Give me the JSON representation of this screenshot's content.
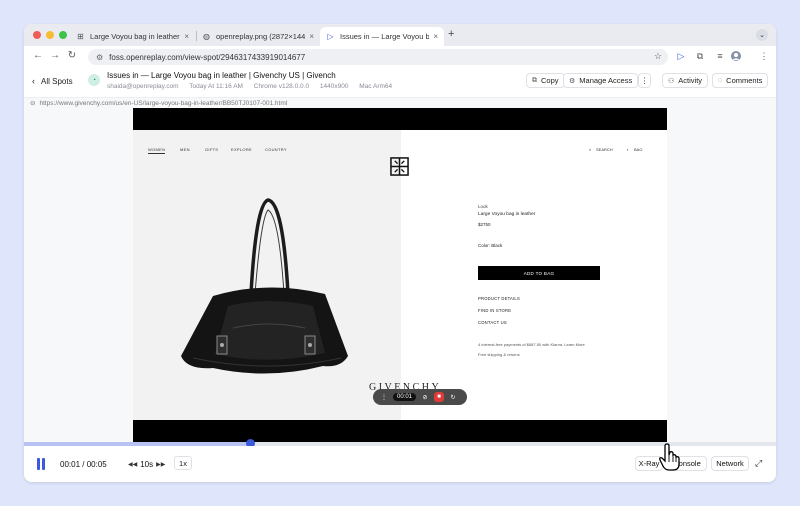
{
  "browser": {
    "tabs": [
      {
        "icon": "grid-icon",
        "label": "Large Voyou bag in leather | G"
      },
      {
        "icon": "globe-icon",
        "label": "openreplay.png (2872×1446)"
      },
      {
        "icon": "play-icon",
        "label": "Issues in — Large Voyou bag in"
      }
    ],
    "address": "foss.openreplay.com/view-spot/2946317433919014677"
  },
  "spot": {
    "back_label": "All Spots",
    "title": "Issues in — Large Voyou bag in leather | Givenchy US | Givench",
    "meta": [
      "shaida@openreplay.com",
      "Today At 11:16 AM",
      "Chrome v128.0.0.0",
      "1440x900",
      "Mac Arm64"
    ],
    "copy_label": "Copy",
    "manage_label": "Manage Access",
    "activity_label": "Activity",
    "comments_label": "Comments",
    "page_url": "https://www.givenchy.com/us/en-US/large-voyou-bag-in-leather/BB50TJ0107-001.html"
  },
  "site": {
    "nav": [
      "WOMEN",
      "MEN",
      "GIFTS",
      "EXPLORE",
      "COUNTRY"
    ],
    "search": "SEARCH",
    "bag": "BAG",
    "wordmark": "GIVENCHY",
    "product_label": "Look",
    "product_title": "Large Voyou bag in leather",
    "price": "$2750",
    "color": "Color: Black",
    "add_to_bag": "ADD TO BAG",
    "links": [
      "PRODUCT DETAILS",
      "FIND IN STORE",
      "CONTACT US"
    ],
    "note1": "4 interest-free payments of $687.50 with Klarna. Learn More",
    "note2": "Free shipping & returns"
  },
  "recorder": {
    "time": "00:01"
  },
  "player": {
    "current": "00:01",
    "separator": "/",
    "total": "00:05",
    "skip": "10s",
    "speed": "1x",
    "xray": "X-Ray",
    "console": "Console",
    "network": "Network",
    "progress": 0.3
  },
  "colors": {
    "accent": "#3b5bdb",
    "background": "#dfe6fb",
    "record": "#e03b3b"
  }
}
